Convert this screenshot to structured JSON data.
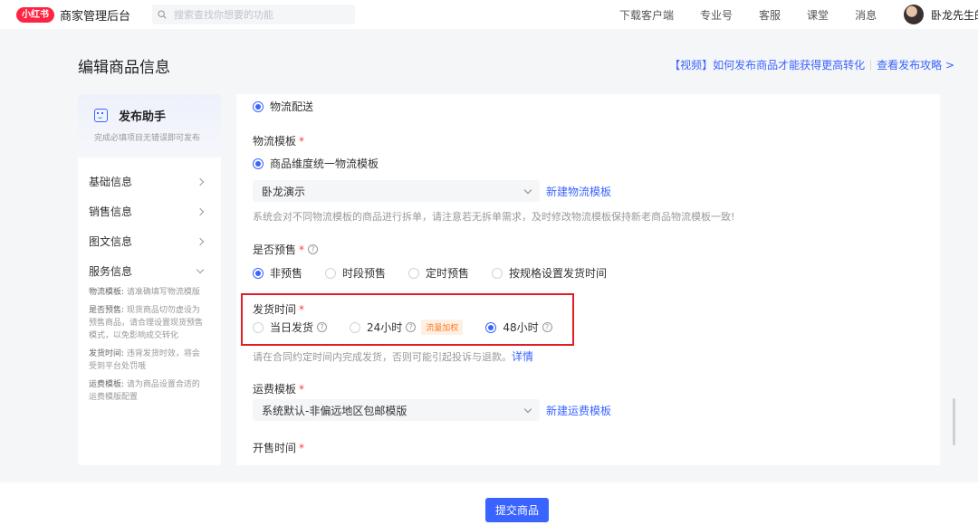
{
  "topbar": {
    "logo": "小红书",
    "title": "商家管理后台",
    "search_placeholder": "搜索查找你想要的功能",
    "nav": [
      "下载客户端",
      "专业号",
      "客服",
      "课堂",
      "消息"
    ],
    "user_name": "卧龙先生的"
  },
  "page": {
    "title": "编辑商品信息",
    "help_link_1": "【视频】如何发布商品才能获得更高转化",
    "help_link_2": "查看发布攻略 >"
  },
  "sidebar": {
    "assistant_title": "发布助手",
    "assistant_sub": "完成必填项目无错误即可发布",
    "items": [
      {
        "label": "基础信息"
      },
      {
        "label": "销售信息"
      },
      {
        "label": "图文信息"
      },
      {
        "label": "服务信息"
      }
    ],
    "tips": [
      {
        "key": "物流模板:",
        "text": "请准确填写物流模版"
      },
      {
        "key": "是否预售:",
        "text": "现货商品切勿虚设为预售商品，请合理设置现货预售模式，以免影响成交转化"
      },
      {
        "key": "发货时间:",
        "text": "违背发货时效，将会受到平台处罚哦"
      },
      {
        "key": "运费模板:",
        "text": "请为商品设置合适的运费模版配置"
      }
    ]
  },
  "form": {
    "delivery_option": "物流配送",
    "logistics_template": {
      "label": "物流模板",
      "option": "商品维度统一物流模板",
      "select_value": "卧龙演示",
      "new_link": "新建物流模板",
      "hint": "系统会对不同物流模板的商品进行拆单，请注意若无拆单需求，及时修改物流模板保持新老商品物流模板一致!"
    },
    "presale": {
      "label": "是否预售",
      "options": [
        "非预售",
        "时段预售",
        "定时预售",
        "按规格设置发货时间"
      ],
      "selected": "非预售"
    },
    "ship_time": {
      "label": "发货时间",
      "options": [
        "当日发货",
        "24小时",
        "48小时"
      ],
      "tag": "流量加权",
      "selected": "48小时",
      "hint": "请在合同约定时间内完成发货，否则可能引起投诉与退款。",
      "detail_link": "详情"
    },
    "freight_template": {
      "label": "运费模板",
      "select_value": "系统默认-非偏远地区包邮模版",
      "new_link": "新建运费模板"
    },
    "sale_time": {
      "label": "开售时间"
    }
  },
  "footer": {
    "submit_label": "提交商品"
  },
  "colors": {
    "brand": "#ff2442",
    "primary": "#3a64ff",
    "highlight_border": "#e01e23"
  }
}
